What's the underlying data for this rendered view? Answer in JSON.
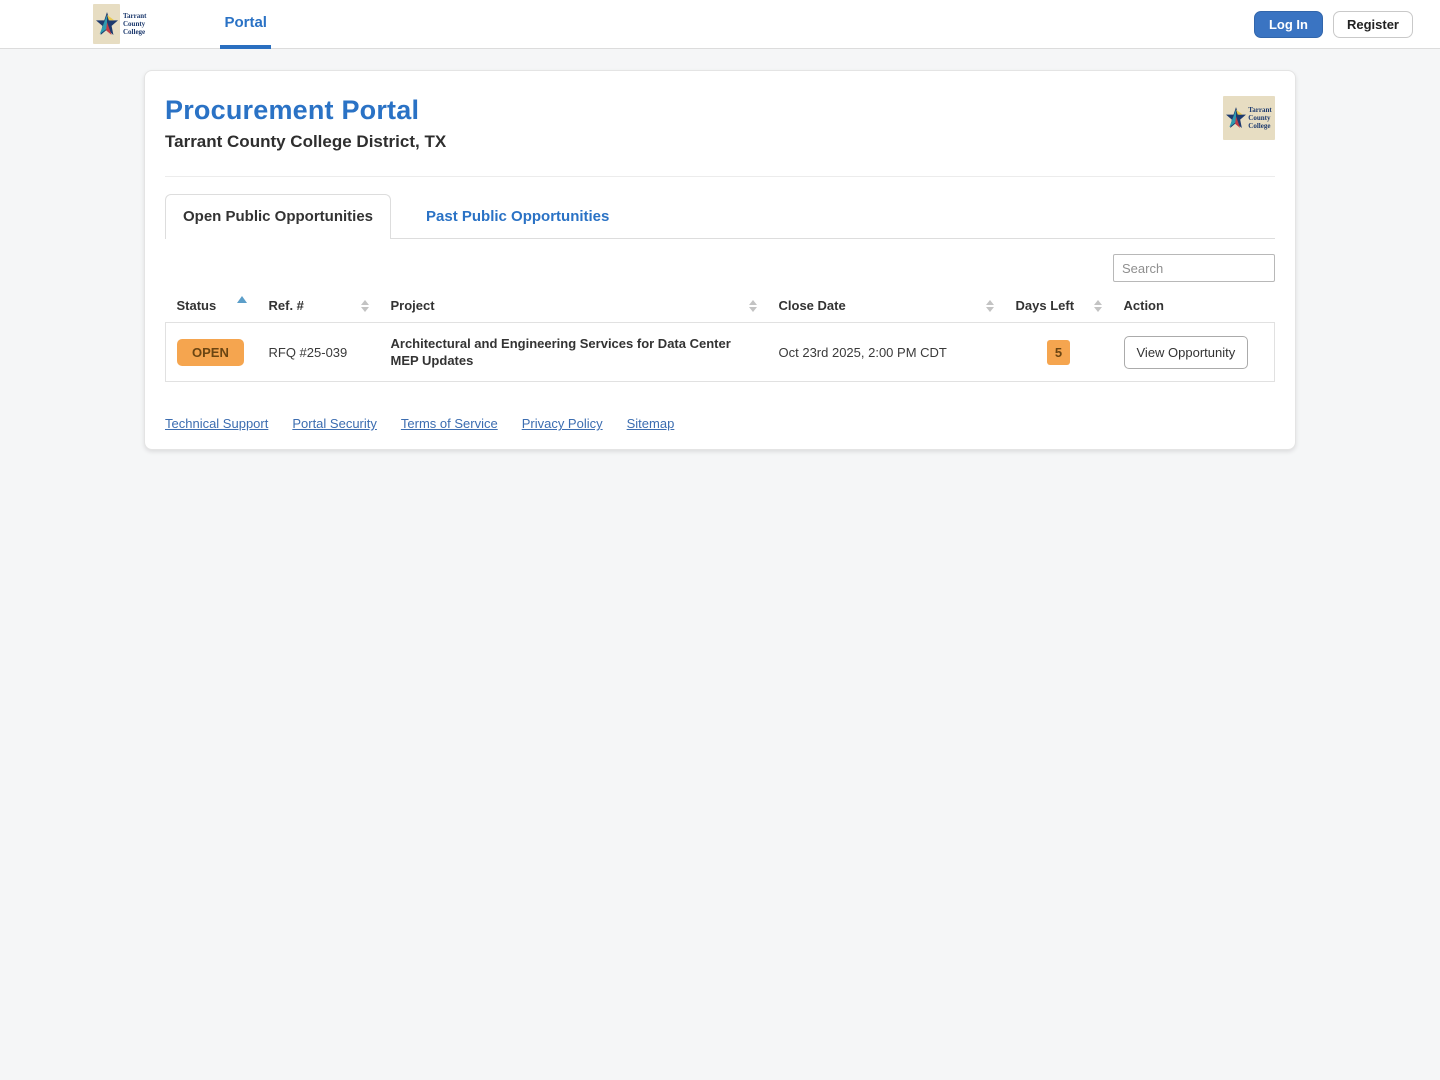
{
  "navbar": {
    "logo_lines": [
      "Tarrant",
      "County",
      "College"
    ],
    "portal_link": "Portal",
    "login_button": "Log In",
    "register_button": "Register"
  },
  "header": {
    "title": "Procurement Portal",
    "subtitle": "Tarrant County College District, TX",
    "logo_lines": [
      "Tarrant",
      "County",
      "College"
    ]
  },
  "tabs": [
    {
      "label": "Open Public Opportunities",
      "active": true
    },
    {
      "label": "Past Public Opportunities",
      "active": false
    }
  ],
  "search": {
    "placeholder": "Search"
  },
  "table": {
    "columns": [
      "Status",
      "Ref. #",
      "Project",
      "Close Date",
      "Days Left",
      "Action"
    ],
    "rows": [
      {
        "status": "OPEN",
        "ref": "RFQ #25-039",
        "project": "Architectural and Engineering Services for Data Center MEP Updates",
        "close_date": "Oct 23rd 2025, 2:00 PM CDT",
        "days_left": "5",
        "action": "View Opportunity"
      }
    ]
  },
  "footer": {
    "links": [
      "Technical Support",
      "Portal Security",
      "Terms of Service",
      "Privacy Policy",
      "Sitemap"
    ]
  },
  "colors": {
    "accent_blue": "#2a72c5",
    "badge_orange": "#f5a54f",
    "badge_text": "#6b4512"
  }
}
